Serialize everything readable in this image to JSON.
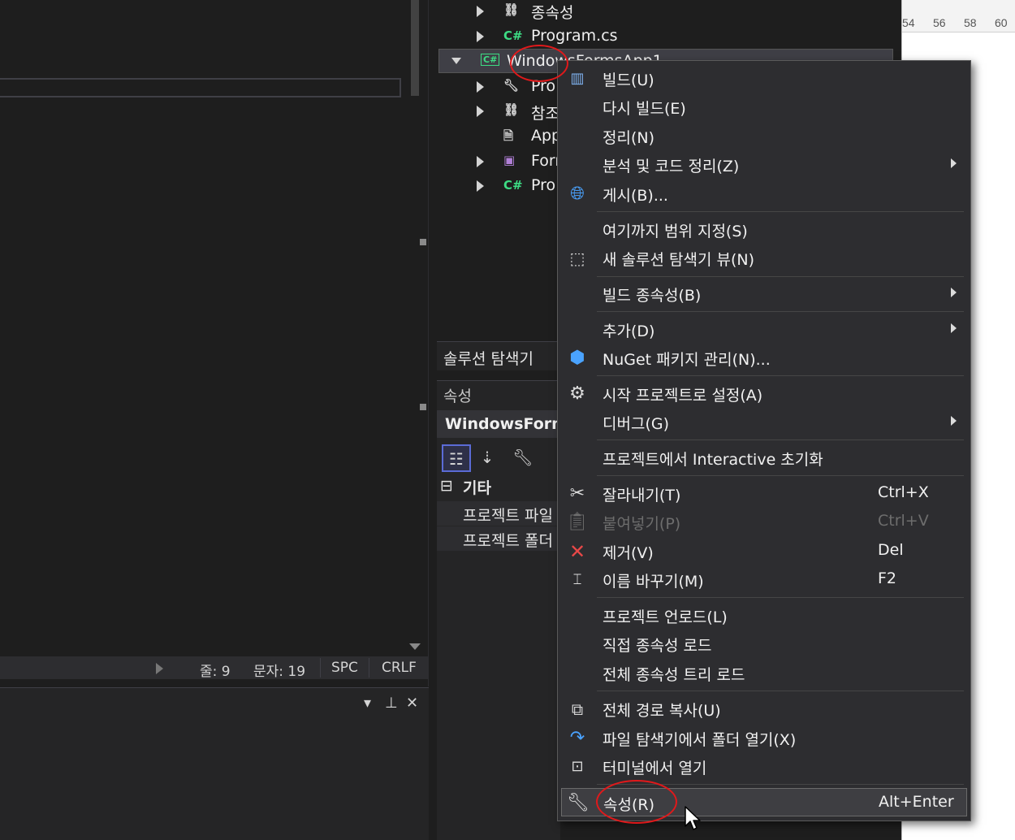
{
  "solution_explorer": {
    "tab_label": "솔루션 탐색기",
    "rows": [
      {
        "label": "종속성",
        "icon": "dependencies-icon"
      },
      {
        "label": "Program.cs",
        "icon": "csharp-file-icon",
        "icon_text": "C#"
      },
      {
        "label": "WindowsFormsApp1",
        "icon": "csharp-project-icon",
        "icon_text": "C#",
        "selected": true
      },
      {
        "label": "Pro",
        "icon": "wrench-icon"
      },
      {
        "label": "참조",
        "icon": "references-icon"
      },
      {
        "label": "App",
        "icon": "config-file-icon"
      },
      {
        "label": "Form",
        "icon": "form-icon"
      },
      {
        "label": "Pro",
        "icon": "csharp-file-icon",
        "icon_text": "C#"
      }
    ]
  },
  "properties": {
    "title": "속성",
    "object_name": "WindowsForms",
    "group_label": "기타",
    "group_toggle": "⊟",
    "rows": [
      "프로젝트 파일",
      "프로젝트 폴더"
    ]
  },
  "statusbar": {
    "col": "줄: 9",
    "chars": "문자: 19",
    "mode": "SPC",
    "eol": "CRLF"
  },
  "ruler_numbers": [
    "54",
    "56",
    "58",
    "60"
  ],
  "context_menu": {
    "items": [
      {
        "label": "빌드(U)",
        "icon": "build-icon"
      },
      {
        "label": "다시 빌드(E)"
      },
      {
        "label": "정리(N)"
      },
      {
        "label": "분석 및 코드 정리(Z)",
        "submenu": true
      },
      {
        "label": "게시(B)...",
        "icon": "globe-icon"
      },
      {
        "label": "여기까지 범위 지정(S)"
      },
      {
        "label": "새 솔루션 탐색기 뷰(N)",
        "icon": "new-view-icon"
      },
      {
        "label": "빌드 종속성(B)",
        "submenu": true
      },
      {
        "label": "추가(D)",
        "submenu": true
      },
      {
        "label": "NuGet 패키지 관리(N)...",
        "icon": "nuget-icon"
      },
      {
        "label": "시작 프로젝트로 설정(A)",
        "icon": "gear-icon"
      },
      {
        "label": "디버그(G)",
        "submenu": true
      },
      {
        "label": "프로젝트에서 Interactive 초기화"
      },
      {
        "label": "잘라내기(T)",
        "shortcut": "Ctrl+X",
        "icon": "scissors-icon"
      },
      {
        "label": "붙여넣기(P)",
        "shortcut": "Ctrl+V",
        "icon": "paste-icon",
        "disabled": true
      },
      {
        "label": "제거(V)",
        "shortcut": "Del",
        "icon": "remove-icon"
      },
      {
        "label": "이름 바꾸기(M)",
        "shortcut": "F2",
        "icon": "rename-icon"
      },
      {
        "label": "프로젝트 언로드(L)"
      },
      {
        "label": "직접 종속성 로드"
      },
      {
        "label": "전체 종속성 트리 로드"
      },
      {
        "label": "전체 경로 복사(U)",
        "icon": "copy-icon"
      },
      {
        "label": "파일 탐색기에서 폴더 열기(X)",
        "icon": "open-folder-icon"
      },
      {
        "label": "터미널에서 열기",
        "icon": "terminal-icon"
      },
      {
        "label": "속성(R)",
        "shortcut": "Alt+Enter",
        "icon": "wrench-icon",
        "highlighted": true
      }
    ]
  },
  "colors": {
    "accent_red": "#e0191b",
    "csharp_green": "#3ddc84",
    "menu_bg": "#2d2d30"
  }
}
